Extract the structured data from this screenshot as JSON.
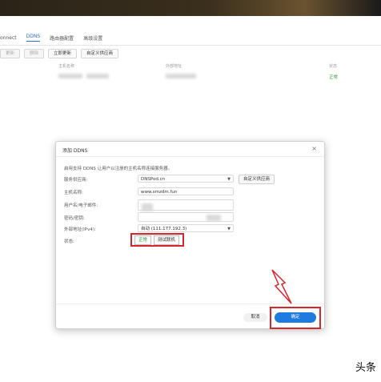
{
  "nav": {
    "items": [
      "onnect",
      "DDNS",
      "路由器配置",
      "高级设置"
    ],
    "active_index": 1
  },
  "toolbar": {
    "refresh": "更新",
    "delete": "删除",
    "update_now": "立即更新",
    "custom_provider": "自定义供应商"
  },
  "table": {
    "headers": [
      "主机名称",
      "外部地址",
      "状态"
    ],
    "row_status": "正常"
  },
  "modal": {
    "title": "添加 DDNS",
    "close": "×",
    "description": "启用支持 DDNS 让用户以注册的主机名称连接服务器。",
    "labels": {
      "provider": "服务供应商:",
      "hostname": "主机名称:",
      "username": "用户名/电子邮件:",
      "password": "密码/密钥:",
      "external_ip": "外部地址(IPv4):",
      "status": "状态:"
    },
    "values": {
      "provider": "DNSPod.cn",
      "hostname": "www.smzdm.fun",
      "external_ip": "自动 (111.177.192.3)"
    },
    "custom_provider_button": "自定义供应商",
    "status_ok": "正常",
    "test_connection": "测试联机",
    "cancel": "取消",
    "ok": "确定"
  },
  "watermark": "头条",
  "colors": {
    "accent": "#1f7be0",
    "highlight_red": "#d8252b",
    "status_green": "#2c9a3a"
  }
}
